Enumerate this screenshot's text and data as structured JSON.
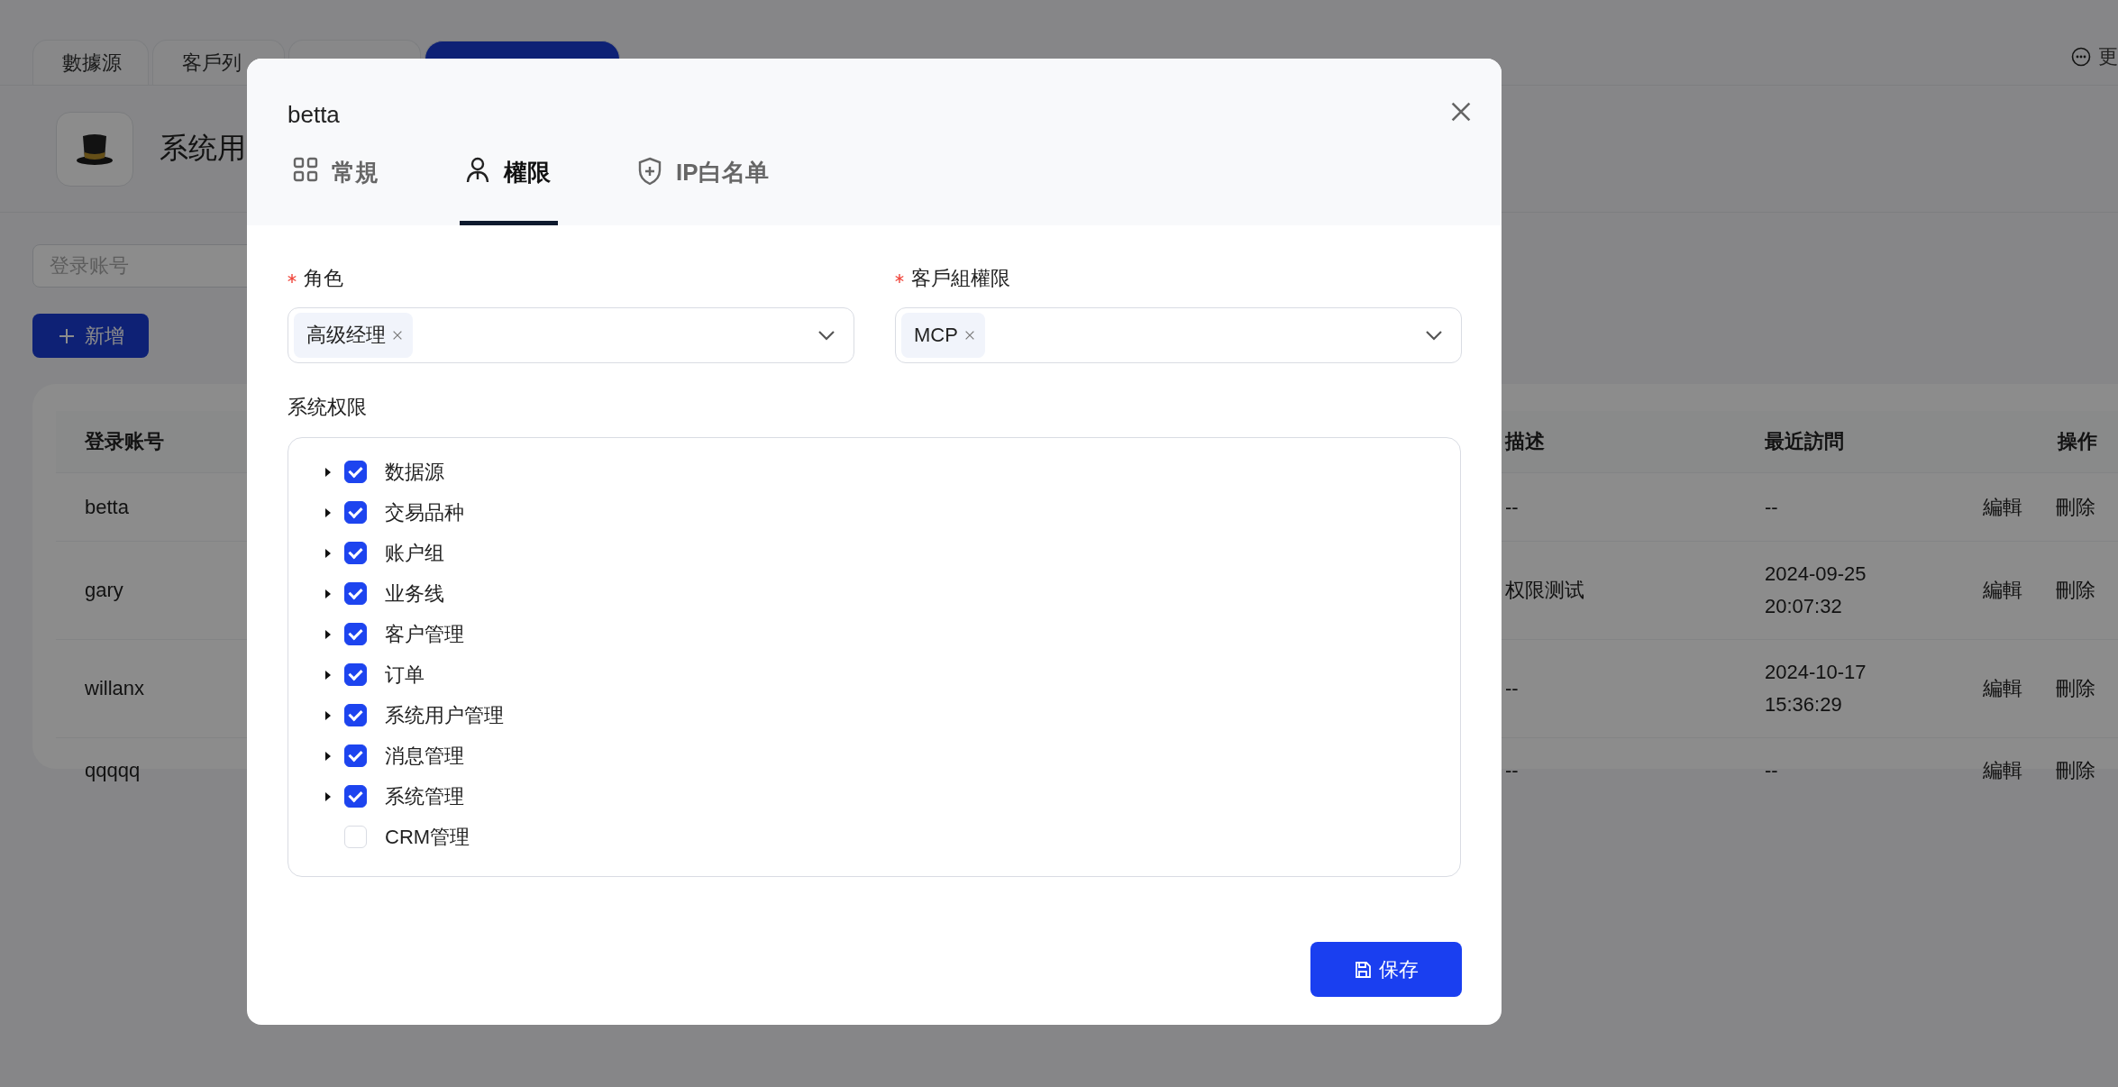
{
  "tabs": [
    {
      "label": "數據源",
      "selected": false
    },
    {
      "label": "客戶列",
      "selected": false
    },
    {
      "selected": false
    },
    {
      "selected": true
    }
  ],
  "more": {
    "label": "更"
  },
  "page_title": "系统用",
  "search": {
    "placeholder": "登录账号"
  },
  "add_button": {
    "label": "新增"
  },
  "table": {
    "columns": [
      "登录账号",
      "描述",
      "最近訪問",
      "操作"
    ],
    "rows": [
      {
        "account": "betta",
        "description": "--",
        "last_visit": "--",
        "actions": [
          "編輯",
          "刪除"
        ]
      },
      {
        "account": "gary",
        "description": "权限测试",
        "last_visit": "2024-09-25 20:07:32",
        "actions": [
          "編輯",
          "刪除"
        ]
      },
      {
        "account": "willanx",
        "description": "--",
        "last_visit": "2024-10-17 15:36:29",
        "actions": [
          "編輯",
          "刪除"
        ]
      },
      {
        "account": "qqqqq",
        "description": "--",
        "last_visit": "--",
        "actions": [
          "編輯",
          "刪除"
        ]
      }
    ]
  },
  "dialog": {
    "title": "betta",
    "tabs": [
      {
        "label": "常規",
        "selected": false
      },
      {
        "label": "權限",
        "selected": true
      },
      {
        "label": "IP白名单",
        "selected": false
      }
    ],
    "fields": [
      {
        "label": "角色",
        "required": true,
        "tags": [
          "高级经理"
        ]
      },
      {
        "label": "客戶組權限",
        "required": true,
        "tags": [
          "MCP"
        ]
      }
    ],
    "tree_label": "系统权限",
    "tree": [
      {
        "label": "数据源",
        "checked": true,
        "expandable": true
      },
      {
        "label": "交易品种",
        "checked": true,
        "expandable": true
      },
      {
        "label": "账户组",
        "checked": true,
        "expandable": true
      },
      {
        "label": "业务线",
        "checked": true,
        "expandable": true
      },
      {
        "label": "客户管理",
        "checked": true,
        "expandable": true
      },
      {
        "label": "订单",
        "checked": true,
        "expandable": true
      },
      {
        "label": "系统用户管理",
        "checked": true,
        "expandable": true
      },
      {
        "label": "消息管理",
        "checked": true,
        "expandable": true
      },
      {
        "label": "系统管理",
        "checked": true,
        "expandable": true
      },
      {
        "label": "CRM管理",
        "checked": false,
        "expandable": false
      }
    ],
    "save_button": "保存"
  }
}
